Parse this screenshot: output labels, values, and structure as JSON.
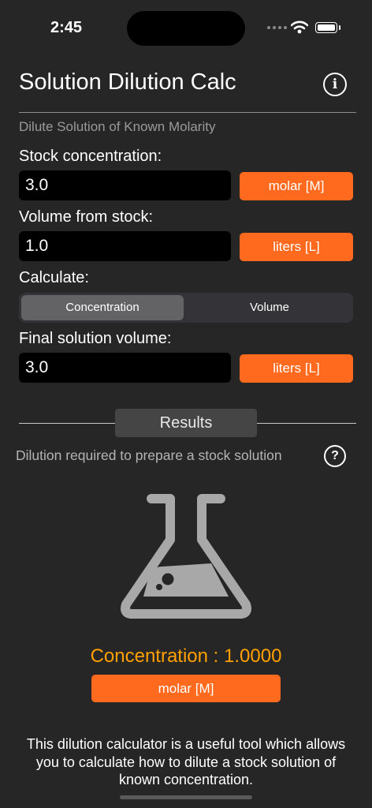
{
  "status_bar": {
    "time": "2:45"
  },
  "header": {
    "title": "Solution Dilution Calc",
    "info_icon": "info-circle-icon"
  },
  "form": {
    "subtitle": "Dilute Solution of Known Molarity",
    "stock_concentration": {
      "label": "Stock concentration:",
      "value": "3.0",
      "unit": "molar [M]"
    },
    "volume_from_stock": {
      "label": "Volume from stock:",
      "value": "1.0",
      "unit": "liters [L]"
    },
    "calculate": {
      "label": "Calculate:",
      "options": [
        "Concentration",
        "Volume"
      ],
      "selected": "Concentration"
    },
    "final_volume": {
      "label": "Final solution volume:",
      "value": "3.0",
      "unit": "liters [L]"
    }
  },
  "results": {
    "tab_label": "Results",
    "description": "Dilution required to prepare a stock solution",
    "help_icon": "question-circle-icon",
    "flask_icon": "flask-icon",
    "result_text": "Concentration : 1.0000",
    "result_unit": "molar [M]"
  },
  "footer": {
    "text": "This dilution calculator is a useful tool which allows you to calculate how to dilute a stock solution of known concentration."
  },
  "colors": {
    "accent": "#ff6a1e",
    "result": "#ffa000",
    "background": "#262626"
  }
}
